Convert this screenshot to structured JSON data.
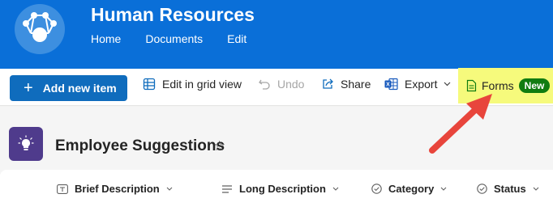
{
  "site": {
    "title": "Human Resources",
    "nav": [
      "Home",
      "Documents",
      "Edit"
    ]
  },
  "commandbar": {
    "add_item": "Add new item",
    "edit_grid": "Edit in grid view",
    "undo": "Undo",
    "share": "Share",
    "export": "Export",
    "forms": "Forms",
    "new_badge": "New"
  },
  "list": {
    "title": "Employee Suggestions",
    "columns": [
      "Brief Description",
      "Long Description",
      "Category",
      "Status"
    ]
  },
  "colors": {
    "header": "#0a6fd8",
    "primary": "#0f6cbd",
    "highlight": "#f6fa7c",
    "badge": "#107c10",
    "list_icon": "#4f3b8c",
    "arrow": "#e8453c"
  },
  "icons": [
    "site-logo-icon",
    "plus-icon",
    "grid-icon",
    "undo-icon",
    "share-icon",
    "excel-icon",
    "chevron-down-icon",
    "form-icon",
    "lightbulb-icon",
    "star-icon",
    "text-column-icon",
    "lines-column-icon",
    "choice-column-icon"
  ]
}
